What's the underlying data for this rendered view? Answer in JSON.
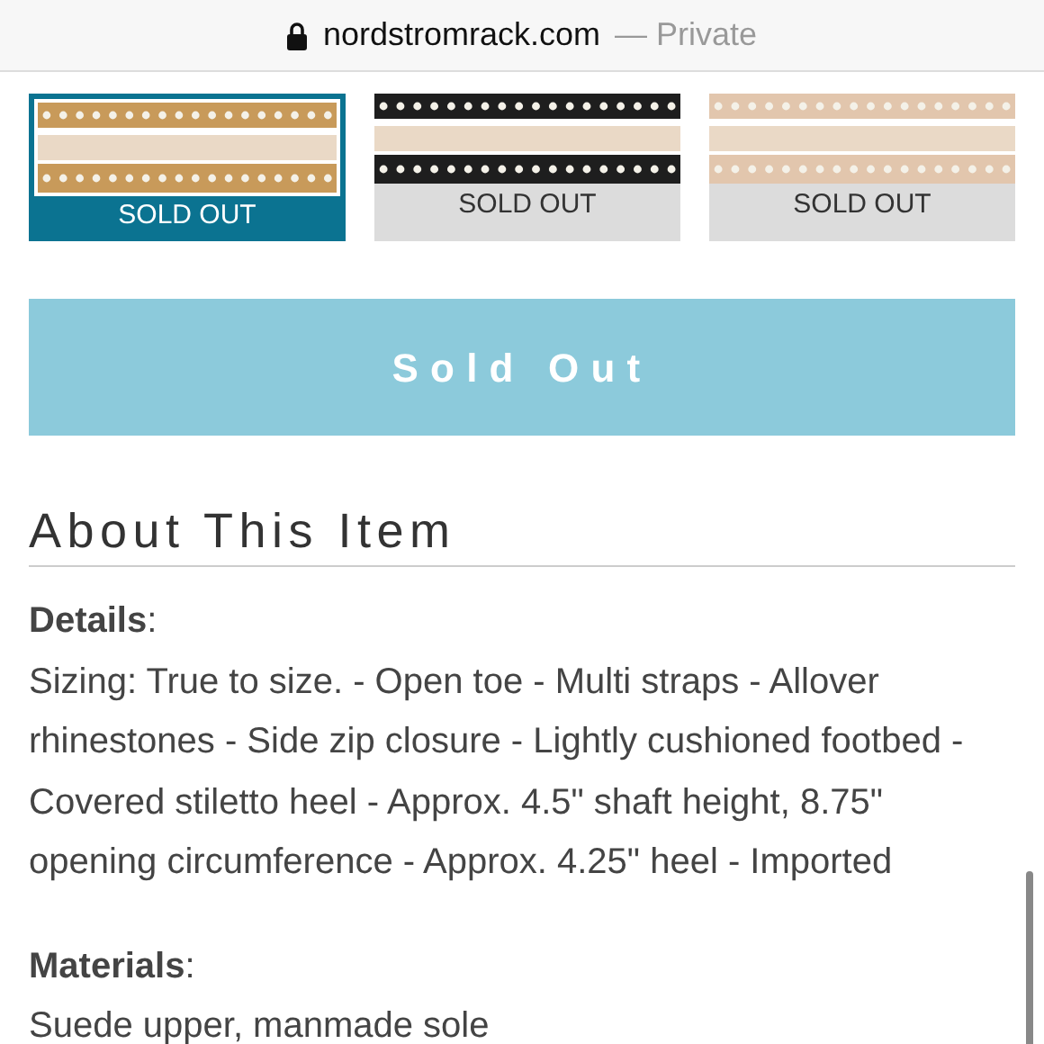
{
  "address_bar": {
    "domain": "nordstromrack.com",
    "mode": "— Private"
  },
  "swatches": [
    {
      "label": "SOLD OUT",
      "selected": true,
      "color": "#c89a5a"
    },
    {
      "label": "SOLD OUT",
      "selected": false,
      "color": "#1e1e1e"
    },
    {
      "label": "SOLD OUT",
      "selected": false,
      "color": "#e2c6ad"
    }
  ],
  "add_button": {
    "label": "Sold Out",
    "disabled": true
  },
  "section_title": "About This Item",
  "details": [
    {
      "heading": "**Details**:",
      "text": "Sizing: True to size. - Open toe - Multi straps - Allover rhinestones - Side zip closure - Lightly cushioned footbed - Covered stiletto heel - Approx. 4.5\" shaft height, 8.75\" opening circumference - Approx. 4.25\" heel - Imported"
    },
    {
      "heading": "**Materials**:",
      "text": "Suede upper, manmade sole"
    }
  ]
}
